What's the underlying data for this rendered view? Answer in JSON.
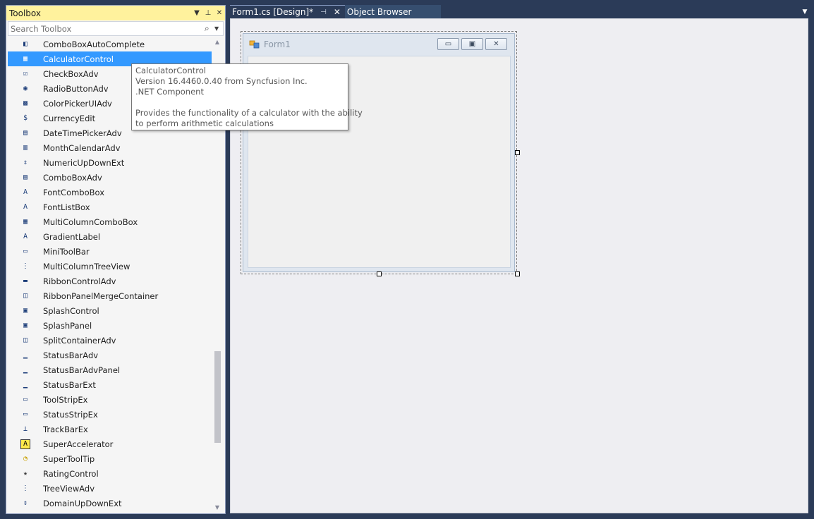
{
  "toolbox": {
    "title": "Toolbox",
    "dropdown_glyph": "▼",
    "pin_glyph": "⊥",
    "close_glyph": "✕",
    "search_placeholder": "Search Toolbox",
    "items": [
      {
        "label": "ComboBoxAutoComplete",
        "icon": "combobox-autocomplete-icon"
      },
      {
        "label": "CalculatorControl",
        "icon": "calculator-icon",
        "selected": true
      },
      {
        "label": "CheckBoxAdv",
        "icon": "checkbox-icon"
      },
      {
        "label": "RadioButtonAdv",
        "icon": "radio-button-icon"
      },
      {
        "label": "ColorPickerUIAdv",
        "icon": "color-picker-icon"
      },
      {
        "label": "CurrencyEdit",
        "icon": "currency-icon"
      },
      {
        "label": "DateTimePickerAdv",
        "icon": "datetime-picker-icon"
      },
      {
        "label": "MonthCalendarAdv",
        "icon": "month-calendar-icon"
      },
      {
        "label": "NumericUpDownExt",
        "icon": "numeric-updown-icon"
      },
      {
        "label": "ComboBoxAdv",
        "icon": "combobox-icon"
      },
      {
        "label": "FontComboBox",
        "icon": "font-combobox-icon"
      },
      {
        "label": "FontListBox",
        "icon": "font-listbox-icon"
      },
      {
        "label": "MultiColumnComboBox",
        "icon": "multicolumn-combobox-icon"
      },
      {
        "label": "GradientLabel",
        "icon": "gradient-label-icon"
      },
      {
        "label": "MiniToolBar",
        "icon": "mini-toolbar-icon"
      },
      {
        "label": "MultiColumnTreeView",
        "icon": "multicolumn-treeview-icon"
      },
      {
        "label": "RibbonControlAdv",
        "icon": "ribbon-control-icon"
      },
      {
        "label": "RibbonPanelMergeContainer",
        "icon": "ribbon-panel-merge-icon"
      },
      {
        "label": "SplashControl",
        "icon": "splash-control-icon"
      },
      {
        "label": "SplashPanel",
        "icon": "splash-panel-icon"
      },
      {
        "label": "SplitContainerAdv",
        "icon": "split-container-icon"
      },
      {
        "label": "StatusBarAdv",
        "icon": "statusbar-icon"
      },
      {
        "label": "StatusBarAdvPanel",
        "icon": "statusbar-panel-icon"
      },
      {
        "label": "StatusBarExt",
        "icon": "statusbar-ext-icon"
      },
      {
        "label": "ToolStripEx",
        "icon": "toolstrip-icon"
      },
      {
        "label": "StatusStripEx",
        "icon": "statusstrip-icon"
      },
      {
        "label": "TrackBarEx",
        "icon": "trackbar-icon"
      },
      {
        "label": "SuperAccelerator",
        "icon": "super-accelerator-icon"
      },
      {
        "label": "SuperToolTip",
        "icon": "super-tooltip-icon"
      },
      {
        "label": "RatingControl",
        "icon": "star-icon"
      },
      {
        "label": "TreeViewAdv",
        "icon": "treeview-icon"
      },
      {
        "label": "DomainUpDownExt",
        "icon": "domain-updown-icon"
      }
    ]
  },
  "tabs": [
    {
      "label": "Form1.cs [Design]*",
      "active": true
    },
    {
      "label": "Object Browser",
      "active": false
    }
  ],
  "designer": {
    "form_title": "Form1",
    "minimize_glyph": "▭",
    "maximize_glyph": "▣",
    "close_glyph": "✕"
  },
  "tooltip": {
    "line1": "CalculatorControl",
    "line2": "Version 16.4460.0.40 from Syncfusion Inc.",
    "line3": ".NET Component",
    "line4": "Provides the functionality of a calculator with the ability",
    "line5": "to perform arithmetic calculations"
  },
  "colors": {
    "toolbox_header": "#fff29d",
    "selection": "#3399ff",
    "chrome": "#2b3b58"
  }
}
